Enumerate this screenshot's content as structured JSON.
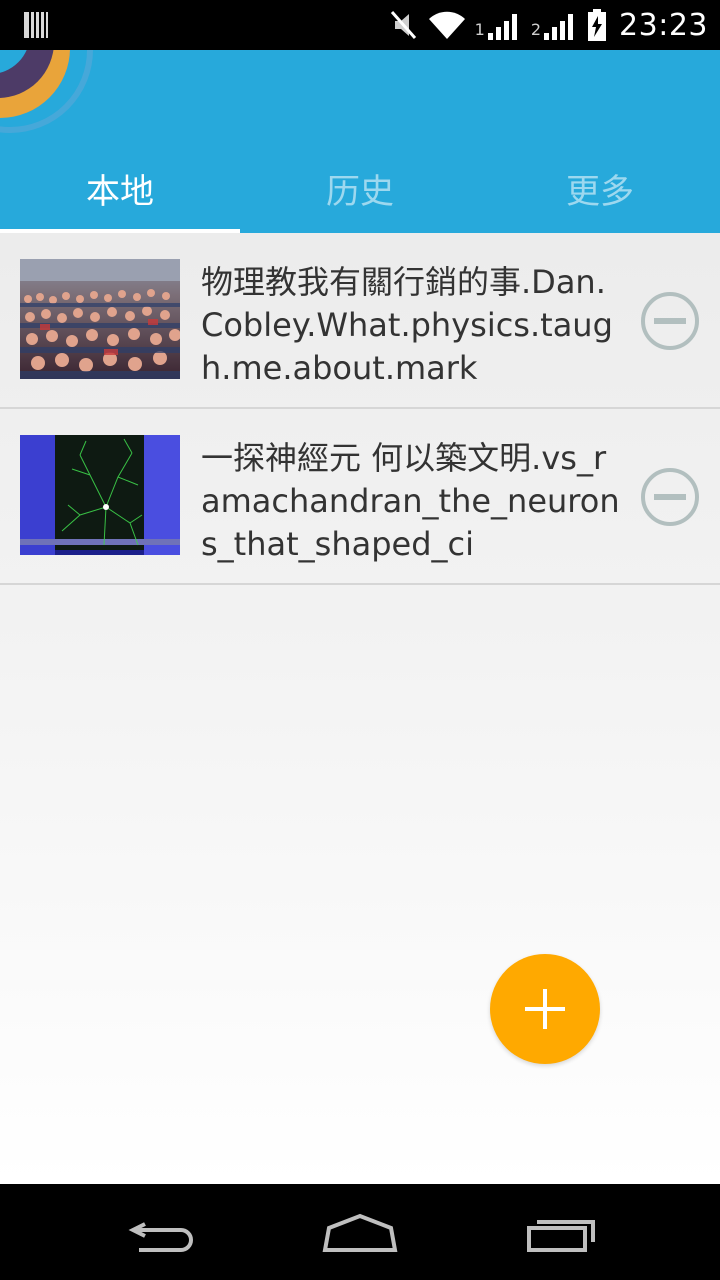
{
  "status_bar": {
    "time": "23:23",
    "sim1_label": "1",
    "sim2_label": "2",
    "icons": [
      "notification-icon",
      "mute-icon",
      "wifi-icon",
      "signal-icon",
      "signal-icon",
      "battery-icon"
    ]
  },
  "tabs": [
    {
      "label": "本地",
      "active": true
    },
    {
      "label": "历史",
      "active": false
    },
    {
      "label": "更多",
      "active": false
    }
  ],
  "videos": [
    {
      "title": "物理教我有關行銷的事.Dan.Cobley.What.physics.taugh.me.about.mark",
      "thumbnail": "audience-photo"
    },
    {
      "title": "一探神經元 何以築文明.vs_ramachandran_the_neurons_that_shaped_ci",
      "thumbnail": "neuron-photo"
    }
  ],
  "colors": {
    "header": "#27a9db",
    "fab": "#ffa900",
    "remove_icon": "#b2bfbf",
    "title_text": "#333333"
  },
  "fab": {
    "icon": "plus-icon"
  },
  "nav_bar": {
    "icons": [
      "back-icon",
      "home-icon",
      "recents-icon"
    ]
  }
}
